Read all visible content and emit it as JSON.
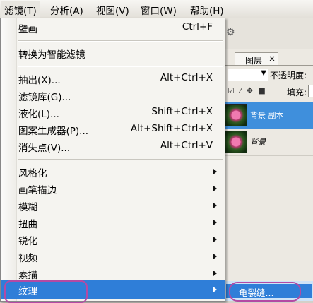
{
  "menubar": {
    "items": [
      "滤镜(T)",
      "分析(A)",
      "视图(V)",
      "窗口(W)",
      "帮助(H)"
    ]
  },
  "layers_panel": {
    "tab_label": "图层",
    "tab_close": "×",
    "opacity_label": "不透明度:",
    "fill_label": "填充:",
    "lock_icons": "☑ ⁄ ✥ ■",
    "layers": [
      {
        "name": "背景 副本",
        "selected": true
      },
      {
        "name": "背景",
        "selected": false
      }
    ]
  },
  "filter_menu": {
    "top": [
      {
        "label": "壁画",
        "shortcut": "Ctrl+F"
      }
    ],
    "group1": [
      {
        "label": "转换为智能滤镜"
      }
    ],
    "group2": [
      {
        "label": "抽出(X)...",
        "shortcut": "Alt+Ctrl+X"
      },
      {
        "label": "滤镜库(G)...",
        "shortcut": ""
      },
      {
        "label": "液化(L)...",
        "shortcut": "Shift+Ctrl+X"
      },
      {
        "label": "图案生成器(P)...",
        "shortcut": "Alt+Shift+Ctrl+X"
      },
      {
        "label": "消失点(V)...",
        "shortcut": "Alt+Ctrl+V"
      }
    ],
    "group3": [
      "风格化",
      "画笔描边",
      "模糊",
      "扭曲",
      "锐化",
      "视频",
      "素描",
      "纹理"
    ],
    "highlighted": "纹理"
  },
  "submenu": {
    "item": "龟裂缝..."
  },
  "colors": {
    "highlight": "#2f7ed8",
    "annotation": "#b34aa4"
  }
}
